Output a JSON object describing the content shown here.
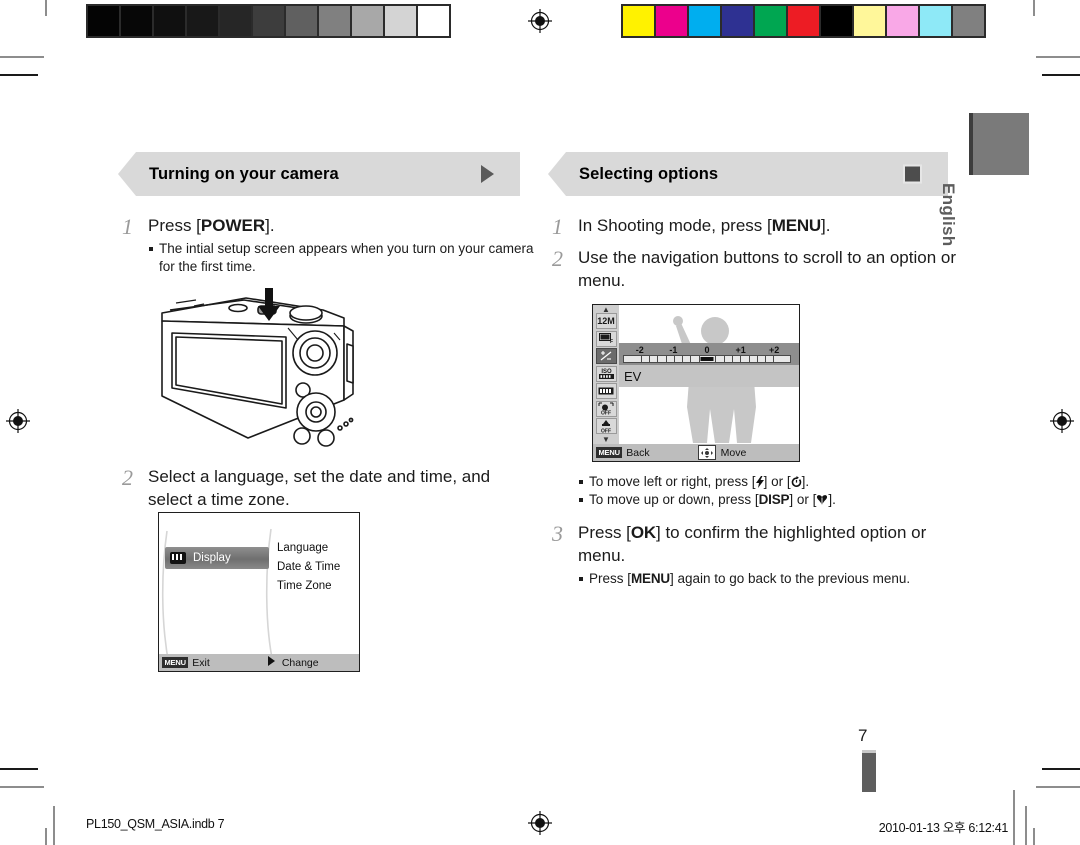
{
  "document": {
    "language_tab": "English",
    "page_number": "7",
    "footer_filename": "PL150_QSM_ASIA.indb   7",
    "footer_timestamp": "2010-01-13   오후 6:12:41"
  },
  "calibration": {
    "grayscale_patches": [
      "#040404",
      "#070707",
      "#101010",
      "#181818",
      "#262626",
      "#3d3d3d",
      "#606060",
      "#808080",
      "#a8a8a8",
      "#d4d4d4",
      "#ffffff"
    ],
    "color_patches": [
      "#fff200",
      "#ec008c",
      "#00aeef",
      "#2e3192",
      "#00a651",
      "#ed1c24",
      "#000000",
      "#fff79a",
      "#f9a8e7",
      "#8ee9f7",
      "#808080"
    ]
  },
  "left_column": {
    "header": {
      "title": "Turning on your camera",
      "icon": "triangle-right-icon"
    },
    "steps": [
      {
        "number": "1",
        "text_before": "Press [",
        "key": "POWER",
        "text_after": "].",
        "bullets": [
          "The intial setup screen appears when you turn on your camera for the first time."
        ]
      },
      {
        "number": "2",
        "text": "Select a language, set the date and time, and select a time zone.",
        "bullets": []
      }
    ],
    "camera_illustration": {
      "label": "camera-rear-view",
      "annotation": "arrow-down-to-power-button"
    },
    "settings_screen": {
      "selected_item": "Display",
      "menu_items": [
        "Language",
        "Date & Time",
        "Time Zone"
      ],
      "footer_left_chip": "MENU",
      "footer_left_label": "Exit",
      "footer_right_icon": "triangle-right-icon",
      "footer_right_label": "Change"
    }
  },
  "right_column": {
    "header": {
      "title": "Selecting options",
      "icon": "square-icon"
    },
    "steps": [
      {
        "number": "1",
        "text_before": "In Shooting mode, press [",
        "key": "MENU",
        "text_after": "]."
      },
      {
        "number": "2",
        "text": "Use the navigation buttons to scroll to an option or menu."
      },
      {
        "number": "3",
        "text_before": "Press [",
        "key": "OK",
        "text_after": "] to confirm the highlighted option or menu.",
        "bullets": [
          {
            "before": "Press [",
            "key": "MENU",
            "after": "] again to go back to the previous menu."
          }
        ]
      }
    ],
    "nav_bullets": [
      {
        "before": "To move left or right, press [",
        "icon1": "flash-icon",
        "middle": "] or [",
        "icon2": "timer-icon",
        "after": "]."
      },
      {
        "before": "To move up or down, press [",
        "icon1": "DISP",
        "middle": "] or [",
        "icon2": "macro-icon",
        "after": "]."
      }
    ],
    "menu_screen": {
      "icons": [
        "12M",
        "quality-icon",
        "ev-icon",
        "ISO",
        "white-balance-icon",
        "face-detect-off-icon",
        "smart-filter-off-icon"
      ],
      "selected_icon": "ev-icon",
      "ev_label": "EV",
      "ev_ticks": [
        "-2",
        "-1",
        "0",
        "+1",
        "+2"
      ],
      "ev_value": "0",
      "footer_left_chip": "MENU",
      "footer_left_label": "Back",
      "footer_right_icon": "dpad-icon",
      "footer_right_label": "Move"
    }
  }
}
